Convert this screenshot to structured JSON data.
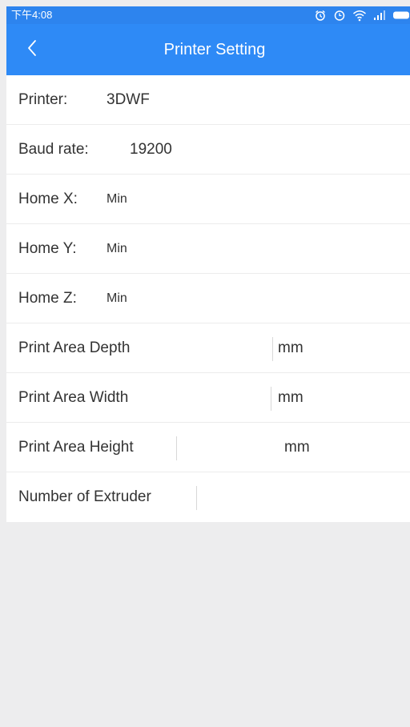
{
  "status_bar": {
    "time": "下午4:08",
    "icons": [
      "alarm-icon",
      "clock-icon",
      "wifi-icon",
      "signal-icon",
      "battery-icon"
    ]
  },
  "app_bar": {
    "title": "Printer Setting",
    "back_icon": "chevron-left-icon"
  },
  "settings": {
    "printer": {
      "label": "Printer:",
      "value": "3DWF"
    },
    "baud_rate": {
      "label": "Baud rate:",
      "value": "19200"
    },
    "home_x": {
      "label": "Home X:",
      "value": "Min"
    },
    "home_y": {
      "label": "Home Y:",
      "value": "Min"
    },
    "home_z": {
      "label": "Home Z:",
      "value": "Min"
    },
    "print_area_depth": {
      "label": "Print Area Depth",
      "value": "",
      "unit": "mm"
    },
    "print_area_width": {
      "label": "Print Area Width",
      "value": "",
      "unit": "mm"
    },
    "print_area_height": {
      "label": "Print Area Height",
      "value": "",
      "unit": "mm"
    },
    "number_of_extruder": {
      "label": "Number of Extruder",
      "value": ""
    }
  },
  "colors": {
    "status_bar": "#2d84ee",
    "app_bar": "#2e8af6",
    "background": "#ededee",
    "row_background": "#ffffff",
    "text": "#333333"
  }
}
